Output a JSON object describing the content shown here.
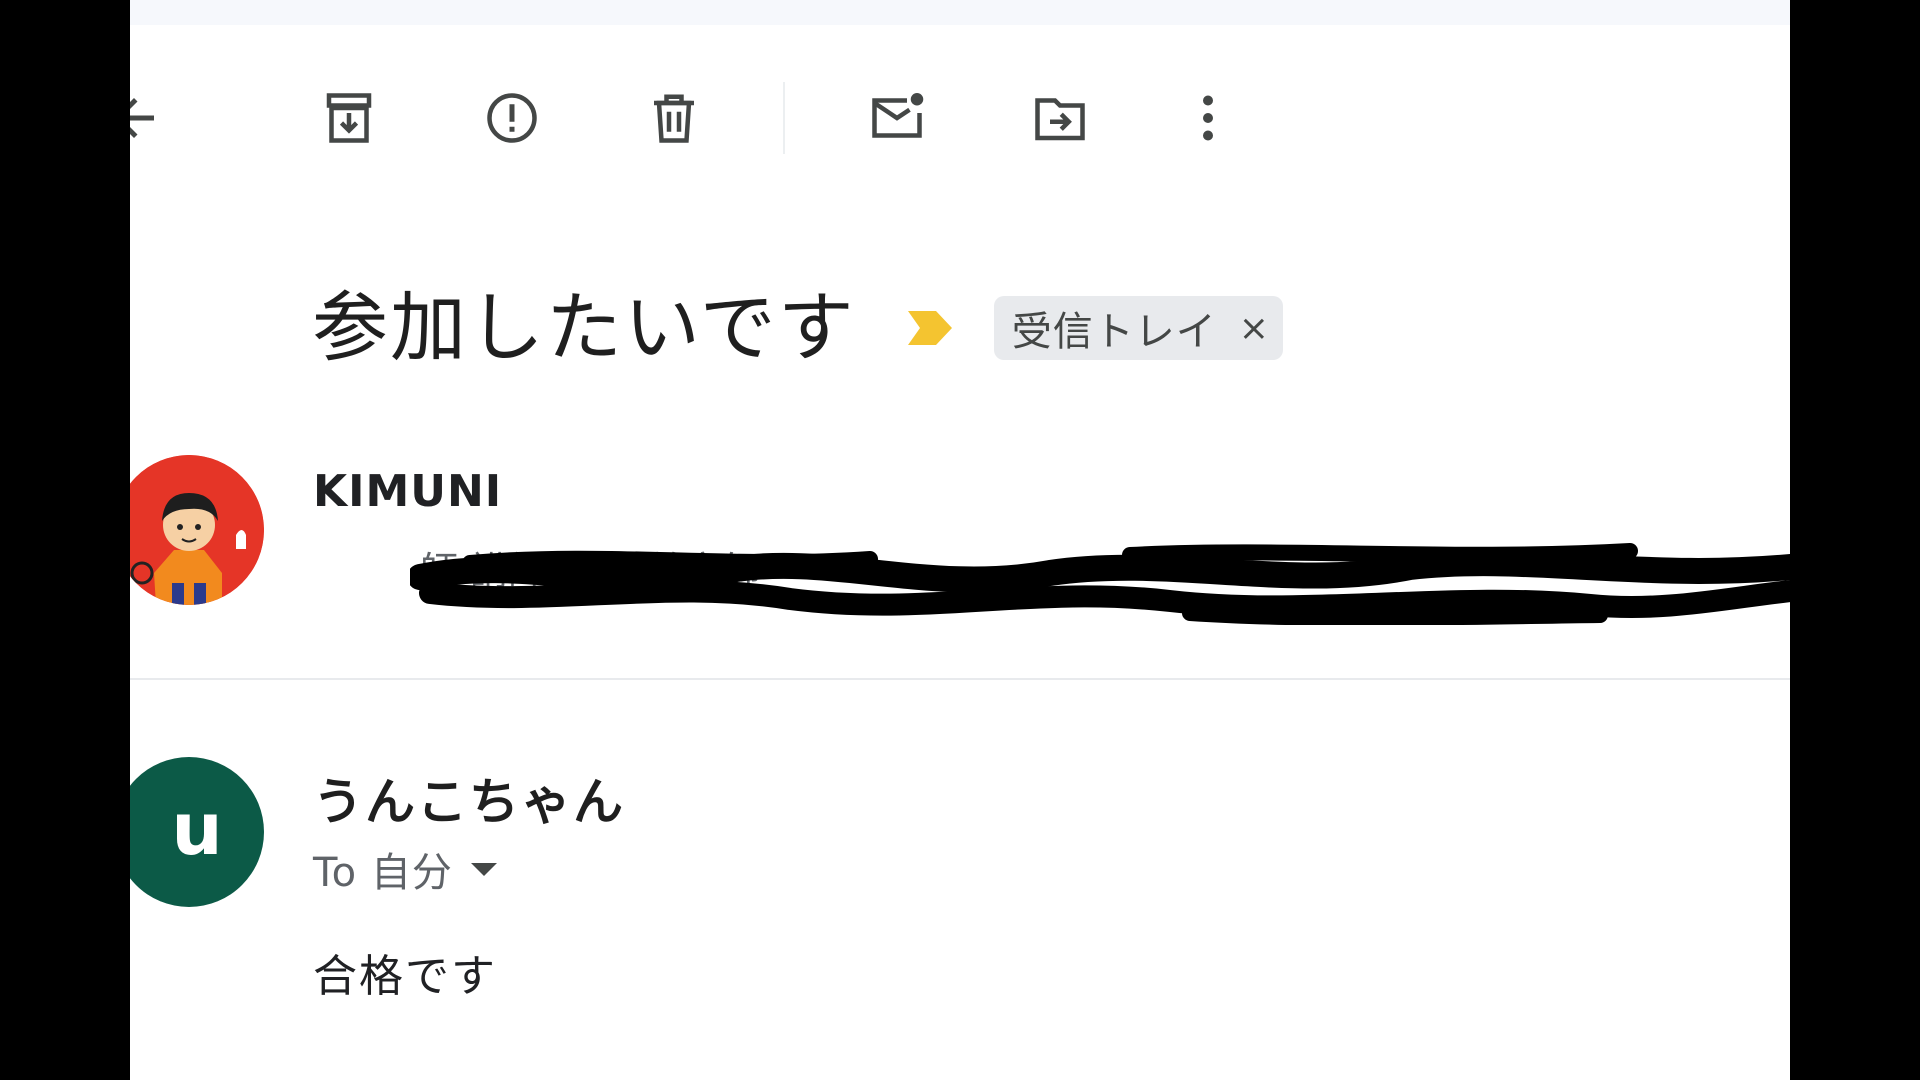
{
  "toolbar": {
    "back": "arrow-left-icon",
    "archive": "archive-icon",
    "spam": "report-spam-icon",
    "delete": "trash-icon",
    "mark_unread": "mark-unread-icon",
    "move_to": "move-to-folder-icon",
    "more": "more-vert-icon"
  },
  "subject": {
    "title": "参加したいです",
    "importance_color": "#f4c430",
    "label": "受信トレイ",
    "label_remove": "×"
  },
  "message1": {
    "sender": "KIMUNI",
    "from_visible_fragment": "師 講師 母親 美容師",
    "avatar_color": "#e53527"
  },
  "message2": {
    "avatar_letter": "u",
    "avatar_color": "#0c5a47",
    "sender": "うんこちゃん",
    "recipient": "To 自分",
    "body": "合格です"
  }
}
